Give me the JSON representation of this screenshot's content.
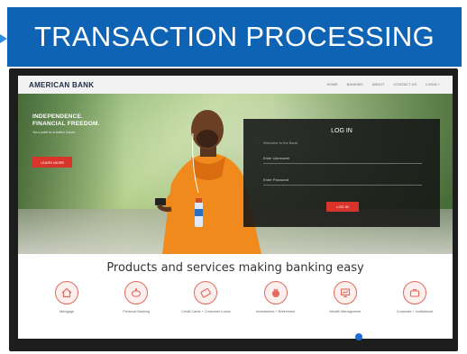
{
  "banner": {
    "title": "TRANSACTION PROCESSING"
  },
  "site": {
    "brand": "AMERICAN BANK",
    "nav": [
      "HOME",
      "BANKING",
      "ABOUT",
      "CONTACT US",
      "LOGIN +"
    ],
    "hero": {
      "headline": "INDEPENDENCE. FINANCIAL FREEDOM.",
      "subtitle": "Your path to a better future",
      "button": "LEARN MORE"
    },
    "login": {
      "title": "LOG IN",
      "subtitle": "Welcome to the Bank",
      "username_label": "Enter Username",
      "password_label": "Enter Password",
      "button": "LOG IN"
    },
    "products_title": "Products and services making banking easy",
    "products": [
      {
        "icon": "home-icon",
        "label": "Mortgage"
      },
      {
        "icon": "piggy-bank-icon",
        "label": "Personal Banking"
      },
      {
        "icon": "credit-card-icon",
        "label": "Credit Cards + Consumer Loans"
      },
      {
        "icon": "money-bag-icon",
        "label": "Investments + Retirement"
      },
      {
        "icon": "chart-screen-icon",
        "label": "Wealth Management"
      },
      {
        "icon": "briefcase-icon",
        "label": "Corporate + Institutional"
      }
    ]
  },
  "colors": {
    "banner": "#0e63b5",
    "accent": "#d9342b",
    "icon_ring": "#e06b5e"
  }
}
